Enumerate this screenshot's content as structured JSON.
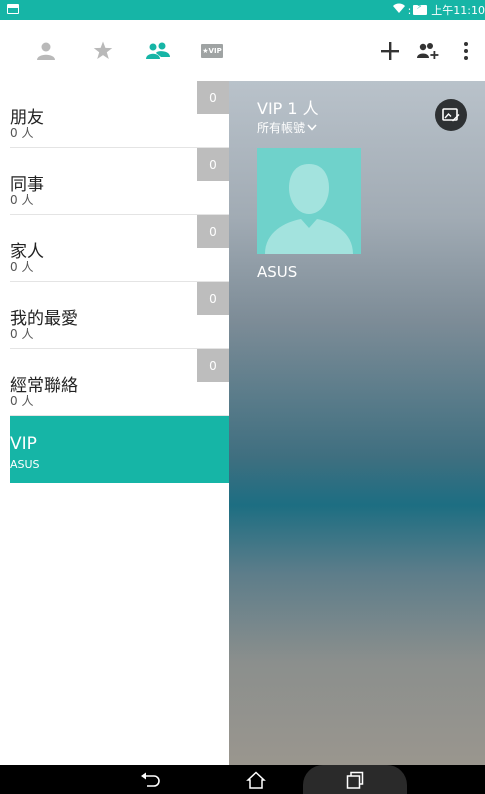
{
  "status_bar": {
    "time": "上午11:10",
    "notification_icon": "image-notification-icon",
    "wifi_icon": "wifi-icon",
    "battery_icon": "battery-charging-icon"
  },
  "toolbar": {
    "tabs": [
      {
        "name": "tab-contacts",
        "icon": "person-icon"
      },
      {
        "name": "tab-favorites",
        "icon": "star-icon"
      },
      {
        "name": "tab-groups",
        "icon": "group-icon",
        "active": true
      },
      {
        "name": "tab-vip",
        "icon": "vip-icon",
        "label": "★VIP"
      }
    ],
    "actions": [
      {
        "name": "add-button",
        "icon": "plus-icon"
      },
      {
        "name": "add-group-button",
        "icon": "add-group-icon"
      },
      {
        "name": "overflow-menu-button",
        "icon": "kebab-icon"
      }
    ]
  },
  "groups": [
    {
      "name": "朋友",
      "count_text": "0 人",
      "badge": "0"
    },
    {
      "name": "同事",
      "count_text": "0 人",
      "badge": "0"
    },
    {
      "name": "家人",
      "count_text": "0 人",
      "badge": "0"
    },
    {
      "name": "我的最愛",
      "count_text": "0 人",
      "badge": "0"
    },
    {
      "name": "經常聯絡",
      "count_text": "0 人",
      "badge": "0"
    },
    {
      "name": "VIP",
      "count_text": "ASUS",
      "selected": true
    }
  ],
  "panel": {
    "title": "VIP 1 人",
    "account_filter": "所有帳號",
    "contacts": [
      {
        "name": "ASUS"
      }
    ]
  },
  "nav_bar": {
    "buttons": [
      "back-icon",
      "home-icon",
      "recent-apps-icon"
    ]
  },
  "colors": {
    "accent": "#16b5a6",
    "badge_bg": "#bdbdbd",
    "avatar_bg": "#6fd2cb"
  }
}
